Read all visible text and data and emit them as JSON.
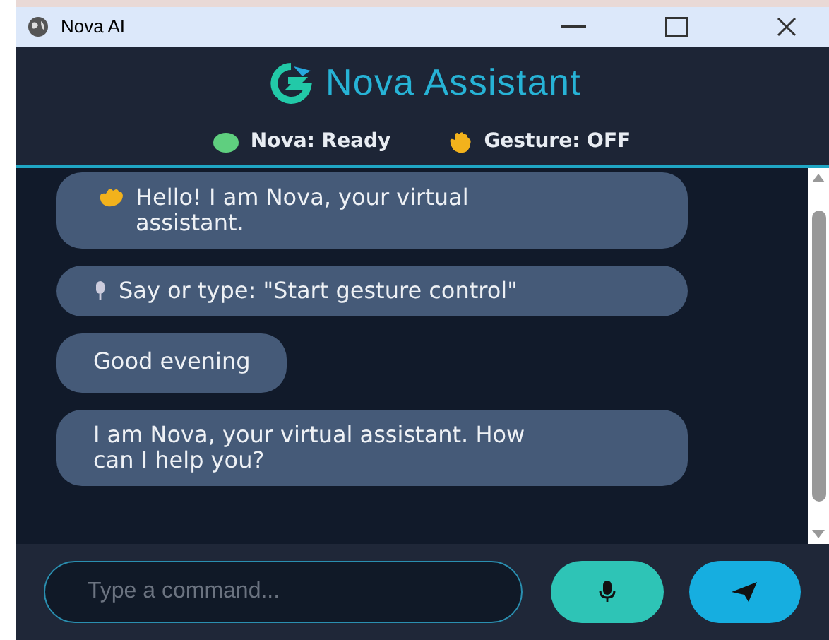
{
  "window": {
    "title": "Nova AI"
  },
  "header": {
    "title": "Nova Assistant",
    "status": [
      {
        "kind": "dot",
        "label": "Nova: Ready"
      },
      {
        "kind": "hand",
        "label": "Gesture: OFF"
      }
    ]
  },
  "messages": [
    {
      "kind": "greeting",
      "text": "Hello! I am Nova, your virtual assistant."
    },
    {
      "kind": "tip",
      "text": "Say or type: \"Start gesture control\""
    },
    {
      "kind": "plain",
      "text": "Good evening"
    },
    {
      "kind": "plain",
      "text": "I am Nova, your virtual assistant. How can I help you?"
    }
  ],
  "input": {
    "placeholder": "Type a command..."
  }
}
